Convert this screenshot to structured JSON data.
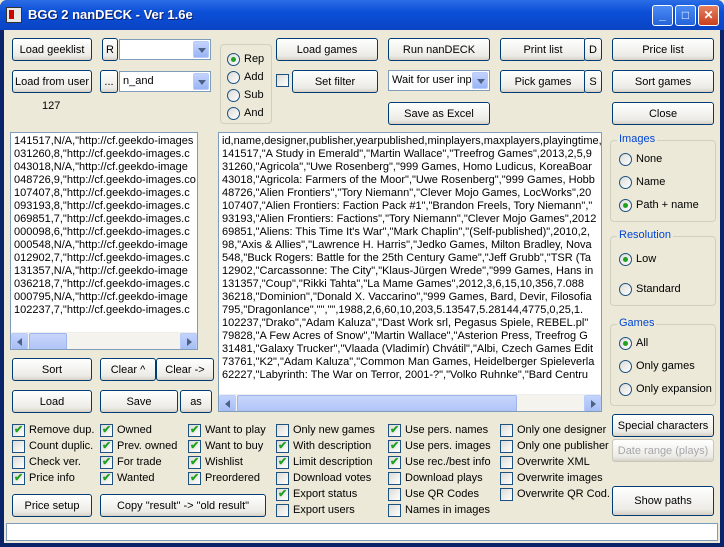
{
  "window": {
    "title": "BGG 2 nanDECK - Ver 1.6e"
  },
  "left": {
    "load_geeklist": "Load geeklist",
    "r_button": "R",
    "combo1": "",
    "load_from_user": "Load from user",
    "ellipsis_button": "...",
    "combo2": "n_and",
    "count": "127",
    "list_lines": [
      "141517,N/A,\"http://cf.geekdo-images",
      "031260,8,\"http://cf.geekdo-images.c",
      "043018,N/A,\"http://cf.geekdo-image",
      "048726,9,\"http://cf.geekdo-images.co",
      "107407,8,\"http://cf.geekdo-images.c",
      "093193,8,\"http://cf.geekdo-images.c",
      "069851,7,\"http://cf.geekdo-images.c",
      "000098,6,\"http://cf.geekdo-images.c",
      "000548,N/A,\"http://cf.geekdo-image",
      "012902,7,\"http://cf.geekdo-images.c",
      "131357,N/A,\"http://cf.geekdo-image",
      "036218,7,\"http://cf.geekdo-images.c",
      "000795,N/A,\"http://cf.geekdo-image",
      "102237,7,\"http://cf.geekdo-images.c"
    ],
    "sort": "Sort",
    "clear_up": "Clear ^",
    "clear_right": "Clear ->",
    "load": "Load",
    "save": "Save",
    "as": "as",
    "price_setup": "Price setup",
    "copy_result": "Copy \"result\" -> \"old result\""
  },
  "mode": {
    "options": [
      "Rep",
      "Add",
      "Sub",
      "And"
    ],
    "selected": "Rep"
  },
  "middle": {
    "load_games": "Load games",
    "run_nandeck": "Run nanDECK",
    "set_filter": "Set filter",
    "wait_combo": "Wait for user inpu",
    "save_as_excel": "Save as Excel",
    "print_list": "Print list",
    "d_button": "D",
    "pick_games": "Pick games",
    "s_button": "S",
    "main_lines": [
      "id,name,designer,publisher,yearpublished,minplayers,maxplayers,playingtime,a",
      "141517,\"A Study in Emerald\",\"Martin Wallace\",\"Treefrog Games\",2013,2,5,9",
      "31260,\"Agricola\",\"Uwe Rosenberg\",\"999 Games, Homo Ludicus, KoreaBoar",
      "43018,\"Agricola: Farmers of the Moor\",\"Uwe Rosenberg\",\"999 Games, Hobb",
      "48726,\"Alien Frontiers\",\"Tory Niemann\",\"Clever Mojo Games, LocWorks\",20",
      "107407,\"Alien Frontiers: Faction Pack #1\",\"Brandon Freels, Tory Niemann\",\"",
      "93193,\"Alien Frontiers: Factions\",\"Tory Niemann\",\"Clever Mojo Games\",2012",
      "69851,\"Aliens: This Time It's War\",\"Mark Chaplin\",\"(Self-published)\",2010,2,",
      "98,\"Axis & Allies\",\"Lawrence H. Harris\",\"Jedko Games, Milton Bradley, Nova",
      "548,\"Buck Rogers: Battle for the 25th Century Game\",\"Jeff Grubb\",\"TSR (Ta",
      "12902,\"Carcassonne: The City\",\"Klaus-Jürgen Wrede\",\"999 Games, Hans in",
      "131357,\"Coup\",\"Rikki Tahta\",\"La Mame Games\",2012,3,6,15,10,356,7.088",
      "36218,\"Dominion\",\"Donald X. Vaccarino\",\"999 Games, Bard, Devir, Filosofia",
      "795,\"Dragonlance\",\"\",\"\",1988,2,6,60,10,203,5.13547,5.28144,4775,0,25,1.",
      "102237,\"Drako\",\"Adam Kaluza\",\"Dast Work srl, Pegasus Spiele, REBEL.pl\"",
      "79828,\"A Few Acres of Snow\",\"Martin Wallace\",\"Asterion Press, Treefrog G",
      "31481,\"Galaxy Trucker\",\"Vlaada (Vladimír) Chvátil\",\"Albi, Czech Games Edit",
      "73761,\"K2\",\"Adam Kaluza\",\"Common Man Games, Heidelberger Spieleverla",
      "62227,\"Labyrinth: The War on Terror, 2001-?\",\"Volko Ruhnke\",\"Bard Centru"
    ]
  },
  "right": {
    "price_list": "Price list",
    "sort_games": "Sort games",
    "close": "Close",
    "images_title": "Images",
    "images_options": [
      "None",
      "Name",
      "Path + name"
    ],
    "images_selected": "Path + name",
    "resolution_title": "Resolution",
    "resolution_options": [
      "Low",
      "Standard"
    ],
    "resolution_selected": "Low",
    "games_title": "Games",
    "games_options": [
      "All",
      "Only games",
      "Only expansion"
    ],
    "games_selected": "All",
    "special_characters": "Special characters",
    "date_range": "Date range (plays)",
    "show_paths": "Show paths"
  },
  "checkboxes": [
    {
      "label": "Remove dup.",
      "checked": true
    },
    {
      "label": "Count duplic.",
      "checked": false
    },
    {
      "label": "Check ver.",
      "checked": false
    },
    {
      "label": "Price info",
      "checked": true
    },
    {
      "label": "Owned",
      "checked": true
    },
    {
      "label": "Prev. owned",
      "checked": true
    },
    {
      "label": "For trade",
      "checked": true
    },
    {
      "label": "Wanted",
      "checked": true
    },
    {
      "label": "Want to play",
      "checked": true
    },
    {
      "label": "Want to buy",
      "checked": true
    },
    {
      "label": "Wishlist",
      "checked": true
    },
    {
      "label": "Preordered",
      "checked": true
    },
    {
      "label": "Only new games",
      "checked": false
    },
    {
      "label": "With description",
      "checked": true
    },
    {
      "label": "Limit description",
      "checked": true
    },
    {
      "label": "Download votes",
      "checked": false
    },
    {
      "label": "Export status",
      "checked": true
    },
    {
      "label": "Export users",
      "checked": false
    },
    {
      "label": "Use pers. names",
      "checked": true
    },
    {
      "label": "Use pers. images",
      "checked": true
    },
    {
      "label": "Use rec./best info",
      "checked": true
    },
    {
      "label": "Download plays",
      "checked": false
    },
    {
      "label": "Use QR Codes",
      "checked": false
    },
    {
      "label": "Names in images",
      "checked": false
    },
    {
      "label": "Only one designer",
      "checked": false
    },
    {
      "label": "Only one publisher",
      "checked": false
    },
    {
      "label": "Overwrite XML",
      "checked": false
    },
    {
      "label": "Overwrite images",
      "checked": false
    },
    {
      "label": "Overwrite QR Cod.",
      "checked": false
    }
  ]
}
